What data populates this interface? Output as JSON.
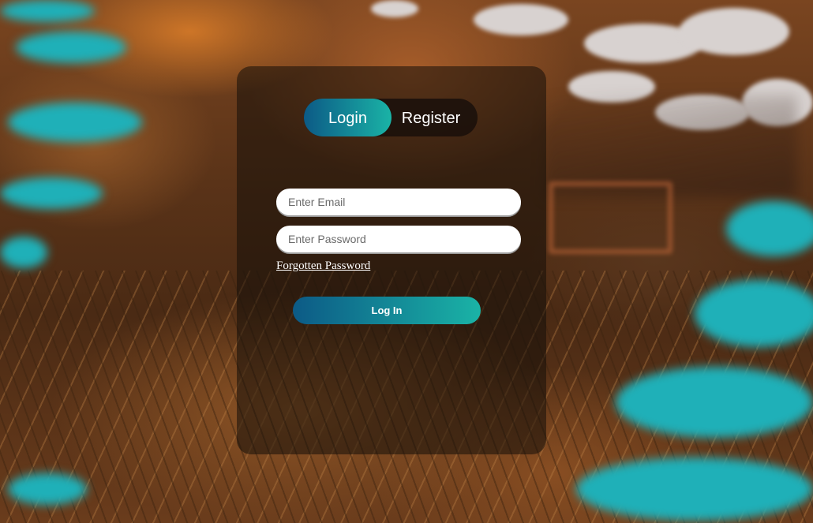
{
  "toggle": {
    "login_label": "Login",
    "register_label": "Register",
    "active": "login"
  },
  "form": {
    "email_placeholder": "Enter Email",
    "password_placeholder": "Enter Password",
    "forgot_label": "Forgotten Password",
    "submit_label": "Log In"
  },
  "colors": {
    "accent_start": "#0c5a86",
    "accent_end": "#1ab3a6"
  }
}
